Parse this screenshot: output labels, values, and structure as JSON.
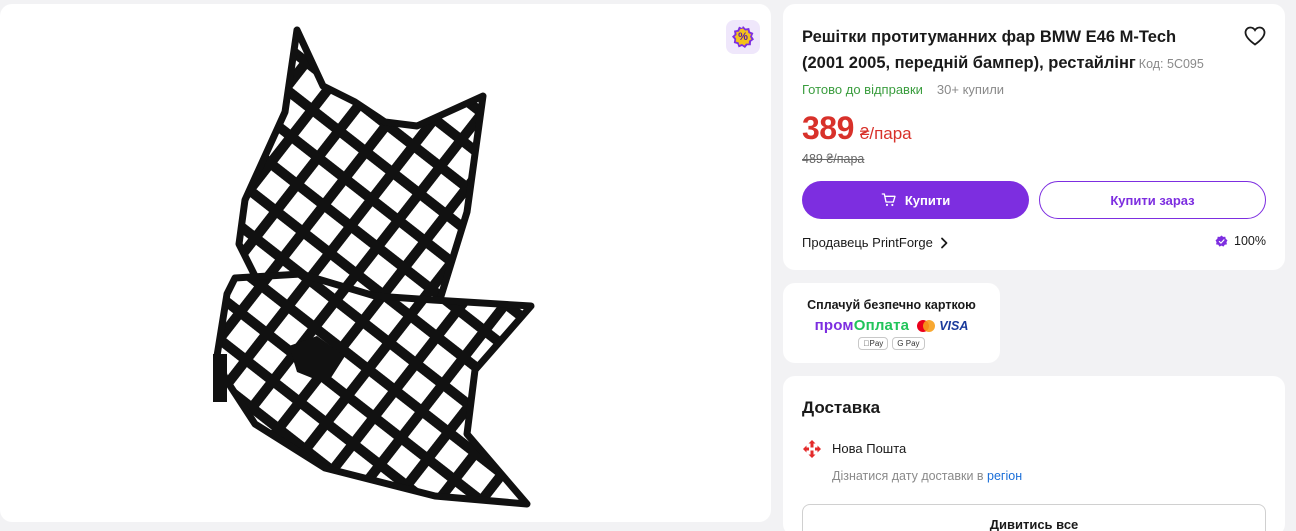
{
  "gallery": {
    "badge_symbol": "%",
    "image_alt": "Решітки протитуманних фар BMW E46 M-Tech"
  },
  "product": {
    "title": "Решітки протитуманних фар BMW E46 M-Tech (2001 2005, передній бампер), рестайлінг",
    "code_label": "Код: 5C095",
    "status_ready": "Готово до відправки",
    "status_bought": "30+ купили",
    "price_value": "389",
    "price_unit": "₴/пара",
    "old_price": "489 ₴/пара",
    "buy_label": "Купити",
    "buy_now_label": "Купити зараз",
    "seller_label": "Продавець PrintForge",
    "rating": "100%"
  },
  "payment": {
    "title": "Сплачуй безпечно карткою",
    "brand_part1": "пром",
    "brand_part2": "Оплата",
    "visa": "VISA",
    "apple_pay": "Pay",
    "google_pay": "G Pay"
  },
  "delivery": {
    "title": "Доставка",
    "carrier": "Нова Пошта",
    "hint_prefix": "Дізнатися дату доставки в ",
    "hint_link": "регіон",
    "see_all": "Дивитись все"
  },
  "colors": {
    "accent": "#7d2ee0",
    "price": "#d8312a",
    "ready": "#3a9d3e",
    "link": "#1a6ed8",
    "nova_poshta": "#e42b2b"
  },
  "icons": {
    "badge": "percent-badge-icon",
    "favorite": "heart-icon",
    "cart": "cart-icon",
    "chevron": "chevron-right-icon",
    "rating": "quality-badge-icon",
    "carrier": "nova-poshta-icon"
  }
}
